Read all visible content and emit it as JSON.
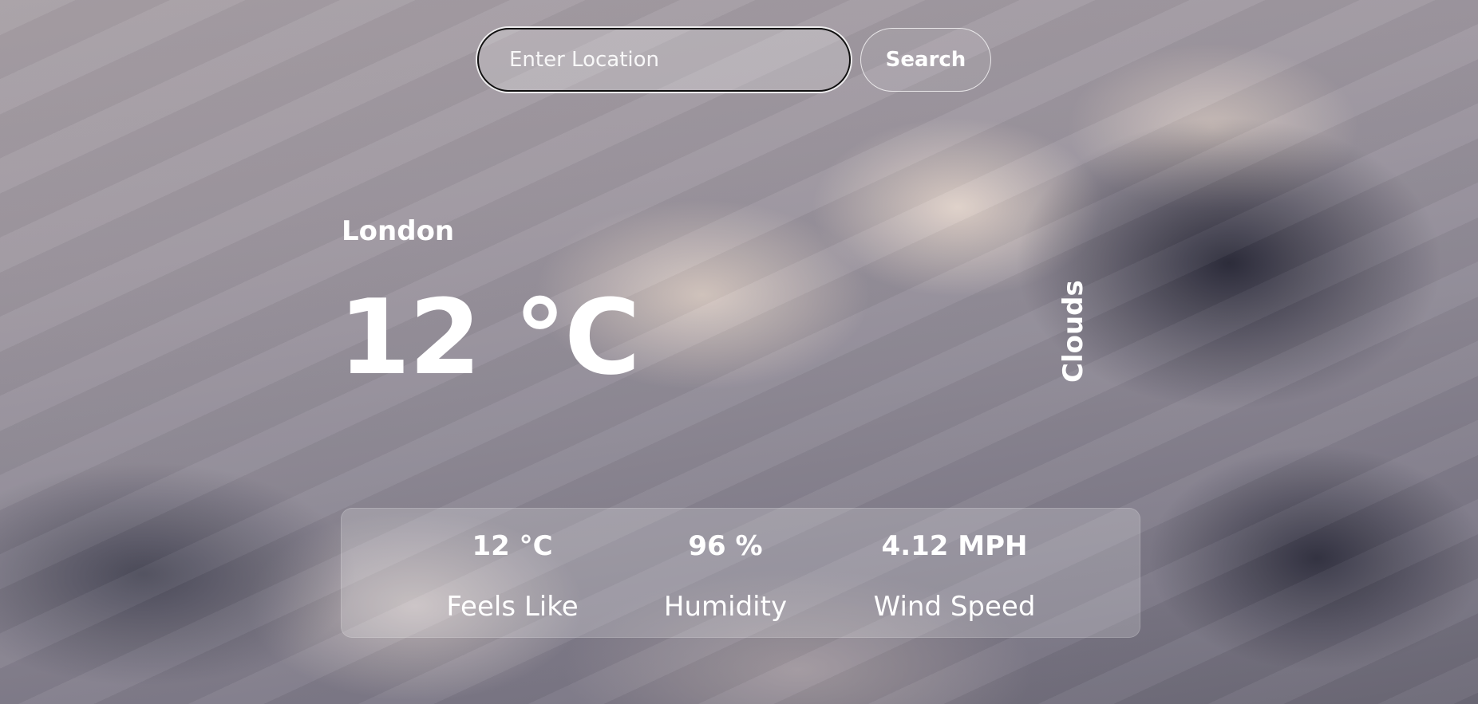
{
  "search": {
    "placeholder": "Enter Location",
    "button_label": "Search"
  },
  "weather": {
    "city": "London",
    "temperature": "12 °C",
    "condition": "Clouds"
  },
  "stats": [
    {
      "value": "12 °C",
      "label": "Feels Like"
    },
    {
      "value": "96 %",
      "label": "Humidity"
    },
    {
      "value": "4.12 MPH",
      "label": "Wind Speed"
    }
  ]
}
